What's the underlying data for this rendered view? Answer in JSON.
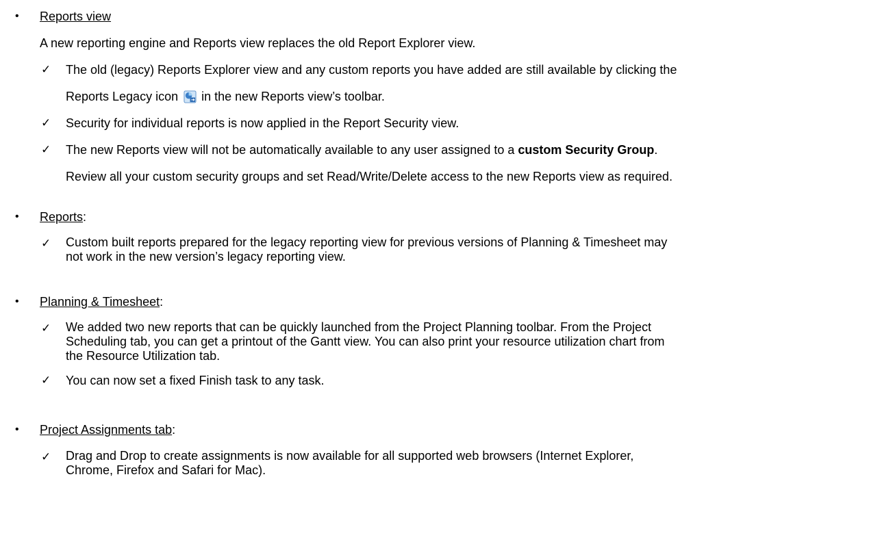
{
  "reports_view": {
    "heading": "Reports view",
    "intro": "A new reporting engine and Reports view replaces the old Report Explorer view.",
    "item1_line1": "The old (legacy) Reports Explorer view and any custom reports you have added are still available by clicking the",
    "item1_line2_before_icon": "Reports Legacy icon",
    "item1_icon": "reports-legacy-icon",
    "item1_line2_after_icon": "in the new Reports view’s toolbar.",
    "item2": "Security for individual reports is now applied in the Report Security view.",
    "item3_before_bold": "The new Reports view will not be automatically available to any user assigned to a ",
    "item3_bold": "custom Security Group",
    "item3_after_bold": ".",
    "item3_line2": "Review all your custom security groups and set Read/Write/Delete access to the new Reports view as required."
  },
  "reports": {
    "heading": "Reports",
    "suffix": ":",
    "item1_line1": "Custom built reports prepared for the legacy reporting view for previous versions of Planning & Timesheet may",
    "item1_line2": "not work in the new version’s legacy reporting view."
  },
  "planning": {
    "heading": "Planning & Timesheet",
    "suffix": ":",
    "item1_line1": "We added two new reports that can be quickly launched from the Project Planning toolbar. From the Project",
    "item1_line2": "Scheduling tab, you can get a printout of the Gantt view. You can also print your resource utilization chart from",
    "item1_line3": "the Resource Utilization tab.",
    "item2": "You can now set a fixed Finish task to any task."
  },
  "assignments": {
    "heading": "Project Assignments tab",
    "suffix": ":",
    "item1_line1": "Drag and Drop to create assignments is now available for all supported web browsers (Internet Explorer,",
    "item1_line2": "Chrome, Firefox and Safari for Mac)."
  },
  "glyphs": {
    "bullet": "•",
    "check": "✓"
  }
}
